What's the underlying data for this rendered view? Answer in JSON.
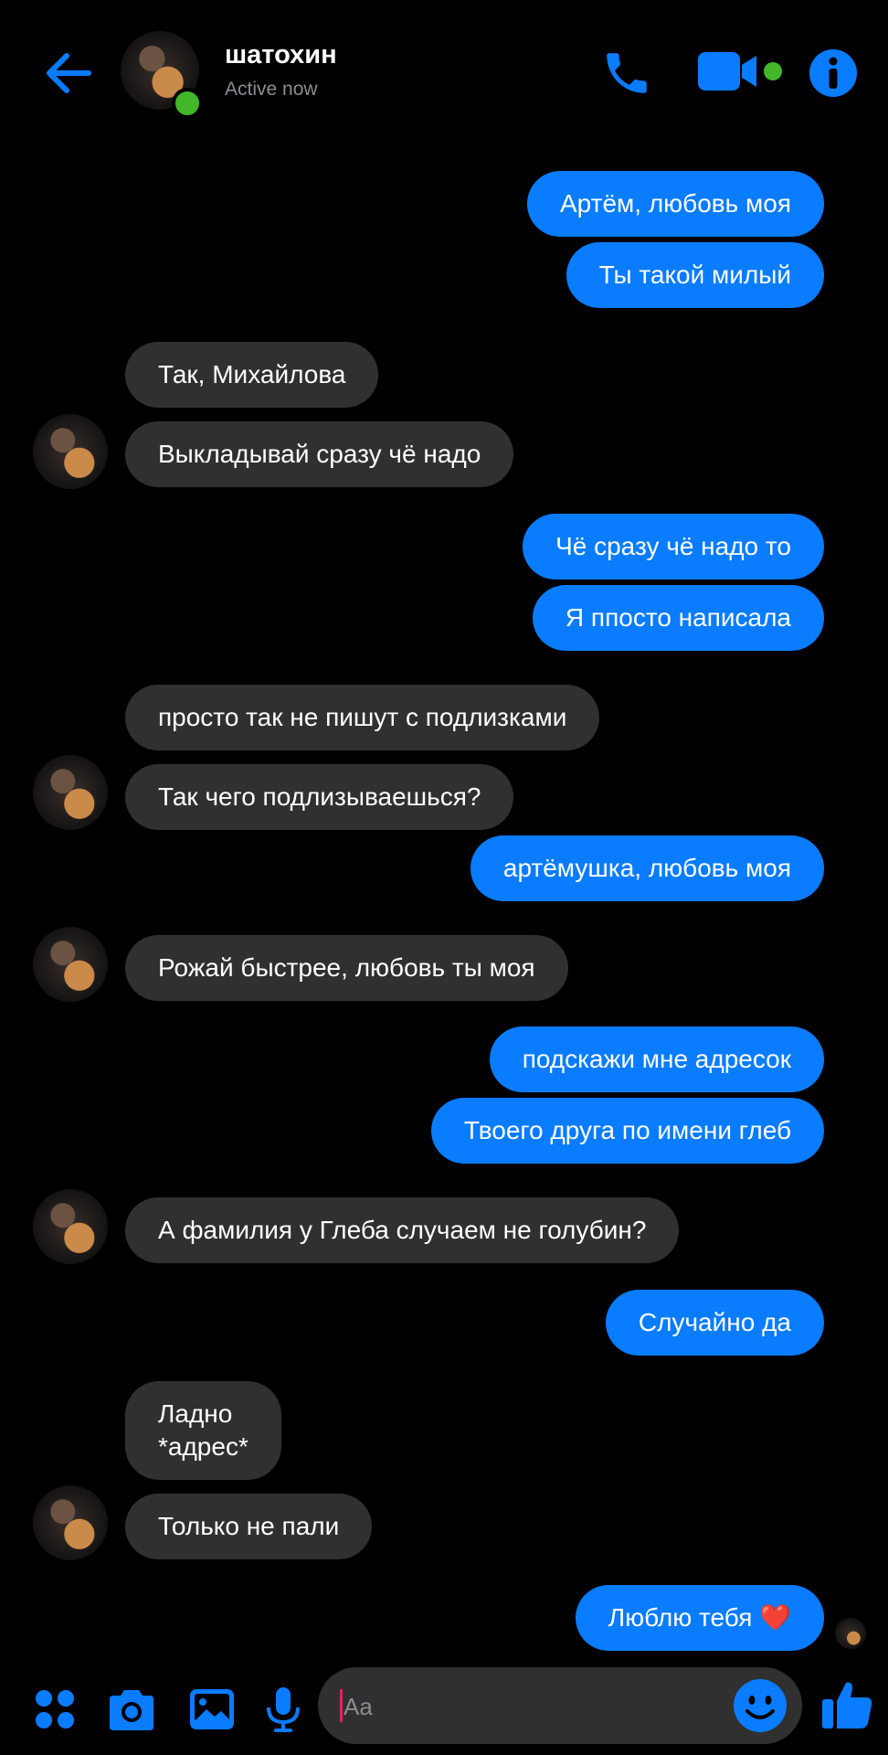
{
  "header": {
    "contact_name": "шатохин",
    "contact_status": "Active now"
  },
  "messages": [
    {
      "side": "out",
      "text": "Артём, любовь моя"
    },
    {
      "side": "out",
      "text": "Ты такой милый"
    },
    {
      "side": "in",
      "text": "Так, Михайлова"
    },
    {
      "side": "in",
      "text": "Выкладывай сразу чё надо"
    },
    {
      "side": "out",
      "text": "Чё сразу чё надо то"
    },
    {
      "side": "out",
      "text": "Я ппосто написала"
    },
    {
      "side": "in",
      "text": "просто так не пишут с подлизками"
    },
    {
      "side": "in",
      "text": "Так чего подлизываешься?"
    },
    {
      "side": "out",
      "text": "артёмушка,  любовь моя"
    },
    {
      "side": "in",
      "text": "Рожай быстрее, любовь ты моя"
    },
    {
      "side": "out",
      "text": "подскажи мне адресок"
    },
    {
      "side": "out",
      "text": "Твоего друга по имени глеб"
    },
    {
      "side": "in",
      "text": "А фамилия у Глеба случаем не голубин?"
    },
    {
      "side": "out",
      "text": "Случайно да"
    },
    {
      "side": "in",
      "text": "Ладно\n*адрес*"
    },
    {
      "side": "in",
      "text": "Только не пали"
    },
    {
      "side": "out",
      "text": "Люблю тебя ❤️"
    }
  ],
  "composer": {
    "placeholder": "Aa"
  },
  "colors": {
    "accent": "#0a7cff",
    "incoming_bubble": "#303030",
    "online": "#42b72a",
    "background": "#000000"
  },
  "icons": {
    "back": "arrow-left-icon",
    "call": "phone-icon",
    "video": "video-camera-icon",
    "info": "info-icon",
    "apps": "apps-grid-icon",
    "camera": "camera-icon",
    "gallery": "image-icon",
    "mic": "microphone-icon",
    "emoji": "smiley-icon",
    "like": "thumbs-up-icon"
  }
}
